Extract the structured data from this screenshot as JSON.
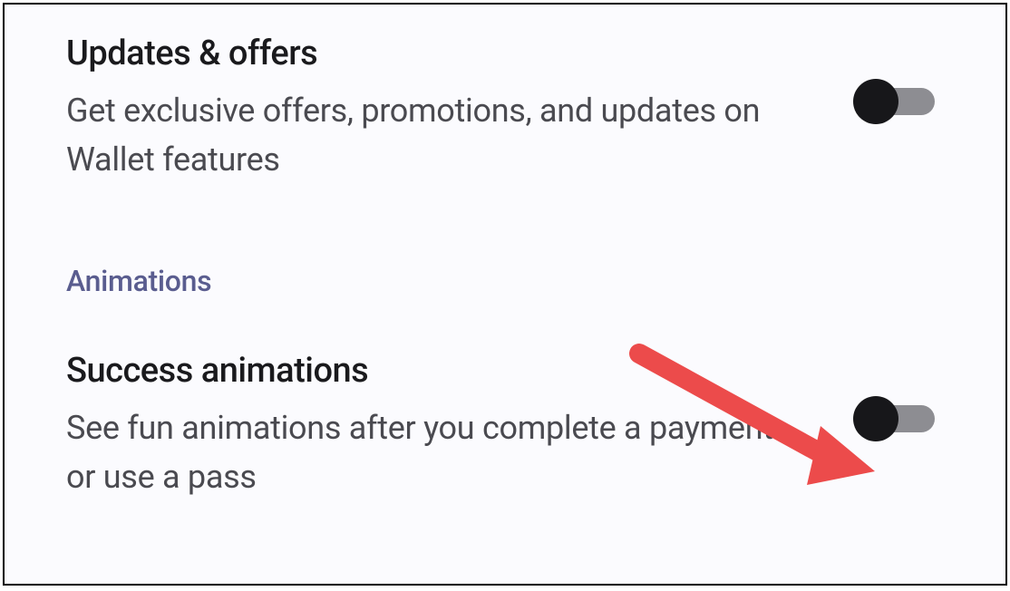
{
  "settings": {
    "updates_offers": {
      "title": "Updates & offers",
      "description": "Get exclusive offers, promotions, and updates on Wallet features",
      "enabled": false
    },
    "section_header": "Animations",
    "success_animations": {
      "title": "Success animations",
      "description": "See fun animations after you complete a payment or use a pass",
      "enabled": false
    }
  }
}
